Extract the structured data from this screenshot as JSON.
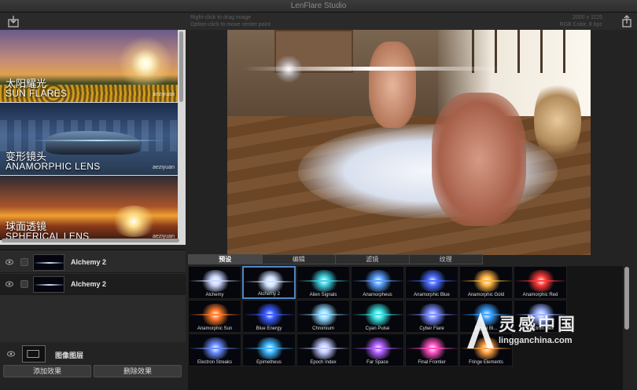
{
  "window": {
    "title": "LenFlare Studio"
  },
  "toolbar": {
    "import_icon": "import-icon",
    "share_icon": "share-icon",
    "hint_line1": "Right-click to drag image",
    "hint_line2": "Option-click to move center point",
    "image_size": "2000 x 1125",
    "color_mode": "RGB Color, 8 bpc"
  },
  "presets": [
    {
      "cn": "太阳耀光",
      "en": "SUN FLARES",
      "watermark": "aeziyuan"
    },
    {
      "cn": "变形镜头",
      "en": "ANAMORPHIC LENS",
      "watermark": "aeziyuan"
    },
    {
      "cn": "球面透镜",
      "en": "SPHERICAL LENS",
      "watermark": "aeziyuan"
    }
  ],
  "layers": [
    {
      "name": "Alchemy 2",
      "selected": false
    },
    {
      "name": "Alchemy 2",
      "selected": true
    }
  ],
  "image_layer": {
    "label": "图像图层"
  },
  "buttons": {
    "add": "添加效果",
    "delete": "删除效果"
  },
  "tabs": [
    {
      "label": "预设",
      "active": true
    },
    {
      "label": "编辑",
      "active": false
    },
    {
      "label": "滤镜",
      "active": false
    },
    {
      "label": "纹理",
      "active": false
    }
  ],
  "effects": [
    {
      "name": "Alchemy",
      "color": "#c9d6ff"
    },
    {
      "name": "Alchemy 2",
      "color": "#cfe0ff",
      "selected": true
    },
    {
      "name": "Alien Signals",
      "color": "#3fd0e0"
    },
    {
      "name": "Anamorpheus",
      "color": "#5aa0ff"
    },
    {
      "name": "Anamorphic Blue",
      "color": "#4a6dff"
    },
    {
      "name": "Anamorphic Gold",
      "color": "#ffb340"
    },
    {
      "name": "Anamorphic Red",
      "color": "#ff3a3a"
    },
    {
      "name": "Anamorphic Sun",
      "color": "#ff7a2a"
    },
    {
      "name": "Blue Energy",
      "color": "#3a5cff"
    },
    {
      "name": "Chromium",
      "color": "#8fd8ff"
    },
    {
      "name": "Cyan Pulse",
      "color": "#38e0e0"
    },
    {
      "name": "Cyber Flare",
      "color": "#7a8cff"
    },
    {
      "name": "Digital Bl...",
      "color": "#3aa0ff"
    },
    {
      "name": "Electron Hex",
      "color": "#9ab0ff"
    },
    {
      "name": "Electron Streaks",
      "color": "#6a8dff"
    },
    {
      "name": "Epimetheus",
      "color": "#40b8ff"
    },
    {
      "name": "Epoch Index",
      "color": "#c0c8ff"
    },
    {
      "name": "Far Space",
      "color": "#b060ff"
    },
    {
      "name": "Final Frontier",
      "color": "#ff50c0"
    },
    {
      "name": "Fringe Elements",
      "color": "#ffa040"
    }
  ],
  "site_watermark": {
    "cn": "灵感中国",
    "url": "lingganchina.com"
  }
}
